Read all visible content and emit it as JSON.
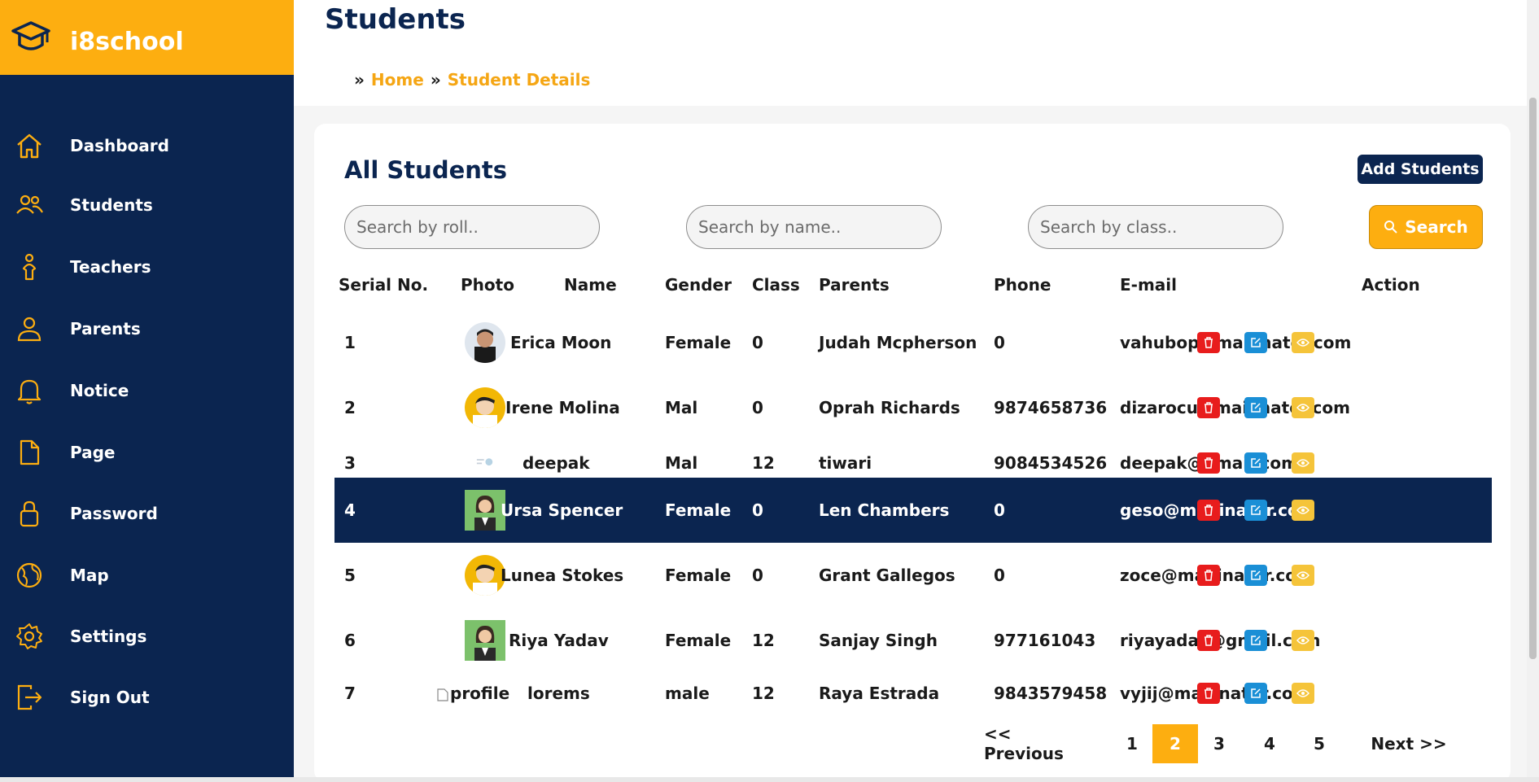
{
  "brand": {
    "name": "i8school"
  },
  "sidebar": {
    "items": [
      {
        "label": "Dashboard",
        "icon": "home-icon"
      },
      {
        "label": "Students",
        "icon": "users-icon"
      },
      {
        "label": "Teachers",
        "icon": "teacher-icon"
      },
      {
        "label": "Parents",
        "icon": "user-icon"
      },
      {
        "label": "Notice",
        "icon": "bell-icon"
      },
      {
        "label": "Page",
        "icon": "file-icon"
      },
      {
        "label": "Password",
        "icon": "lock-icon"
      },
      {
        "label": "Map",
        "icon": "globe-icon"
      },
      {
        "label": "Settings",
        "icon": "gear-icon"
      },
      {
        "label": "Sign Out",
        "icon": "signout-icon"
      }
    ]
  },
  "page": {
    "title": "Students",
    "breadcrumb": {
      "sep": "»",
      "home": "Home",
      "current": "Student Details"
    }
  },
  "card": {
    "title": "All Students",
    "add_button": "Add Students",
    "search": {
      "roll_placeholder": "Search by roll..",
      "name_placeholder": "Search by name..",
      "class_placeholder": "Search by class..",
      "button": "Search"
    },
    "columns": [
      "Serial No.",
      "Photo",
      "Name",
      "Gender",
      "Class",
      "Parents",
      "Phone",
      "E-mail",
      "Action"
    ],
    "rows": [
      {
        "serial": "1",
        "name": "Erica Moon",
        "gender": "Female",
        "class": "0",
        "parents": "Judah Mcpherson",
        "phone": "0",
        "email": "vahubop@mailinator.com",
        "photo": "man-portrait"
      },
      {
        "serial": "2",
        "name": "Irene Molina",
        "gender": "Mal",
        "class": "0",
        "parents": "Oprah Richards",
        "phone": "9874658736",
        "email": "dizarocu@mailinator.com",
        "photo": "cartoon-avatar"
      },
      {
        "serial": "3",
        "name": "deepak",
        "gender": "Mal",
        "class": "12",
        "parents": "tiwari",
        "phone": "9084534526",
        "email": "deepak@gmail.com",
        "photo": "small-screenshot"
      },
      {
        "serial": "4",
        "name": "Ursa Spencer",
        "gender": "Female",
        "class": "0",
        "parents": "Len Chambers",
        "phone": "0",
        "email": "geso@mailinator.com",
        "photo": "woman-avatar"
      },
      {
        "serial": "5",
        "name": "Lunea Stokes",
        "gender": "Female",
        "class": "0",
        "parents": "Grant Gallegos",
        "phone": "0",
        "email": "zoce@mailinator.com",
        "photo": "cartoon-avatar"
      },
      {
        "serial": "6",
        "name": "Riya Yadav",
        "gender": "Female",
        "class": "12",
        "parents": "Sanjay Singh",
        "phone": "977161043",
        "email": "riyayadav@gmail.com",
        "photo": "woman-avatar"
      },
      {
        "serial": "7",
        "name": "lorems",
        "gender": "male",
        "class": "12",
        "parents": "Raya Estrada",
        "phone": "9843579458",
        "email": "vyjij@mailinator.com",
        "photo": "broken",
        "photo_alt": "profile"
      }
    ],
    "selected_row": 4,
    "pagination": {
      "prev": "<< Previous",
      "pages": [
        "1",
        "2",
        "3",
        "4",
        "5"
      ],
      "current": "2",
      "next": "Next >>"
    }
  },
  "colors": {
    "sidebar": "#0b2550",
    "accent": "#fdae10",
    "delete": "#e81c1c",
    "edit": "#1a8fd6",
    "view": "#f5c43a"
  }
}
